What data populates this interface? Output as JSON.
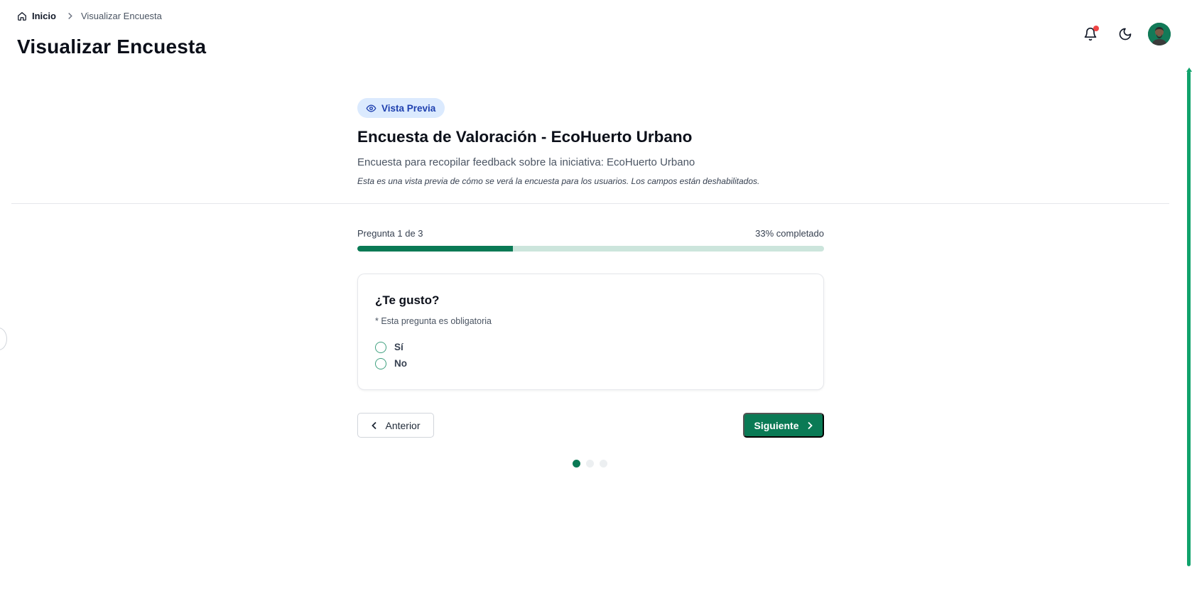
{
  "breadcrumb": {
    "home_label": "Inicio",
    "current_label": "Visualizar Encuesta"
  },
  "page": {
    "title": "Visualizar Encuesta"
  },
  "header_icons": [
    "bell-icon",
    "moon-icon",
    "avatar"
  ],
  "notification_dot_color": "#ef4444",
  "preview": {
    "badge_label": "Vista Previa",
    "survey_title": "Encuesta de Valoración - EcoHuerto Urbano",
    "description": "Encuesta para recopilar feedback sobre la iniciativa: EcoHuerto Urbano",
    "note": "Esta es una vista previa de cómo se verá la encuesta para los usuarios. Los campos están deshabilitados."
  },
  "progress": {
    "question_counter": "Pregunta 1 de 3",
    "percent_label": "33% completado",
    "fraction": 0.333
  },
  "question": {
    "text": "¿Te gusto?",
    "required_note": "* Esta pregunta es obligatoria",
    "options": [
      {
        "label": "Sí",
        "selected": false
      },
      {
        "label": "No",
        "selected": false
      }
    ]
  },
  "navigation": {
    "prev_label": "Anterior",
    "next_label": "Siguiente",
    "total_steps": 3,
    "current_step": 1
  },
  "colors": {
    "accent": "#0a7a55",
    "progress_track": "#cce5dc",
    "badge_bg": "#dbeafe",
    "badge_text": "#1e40af"
  }
}
